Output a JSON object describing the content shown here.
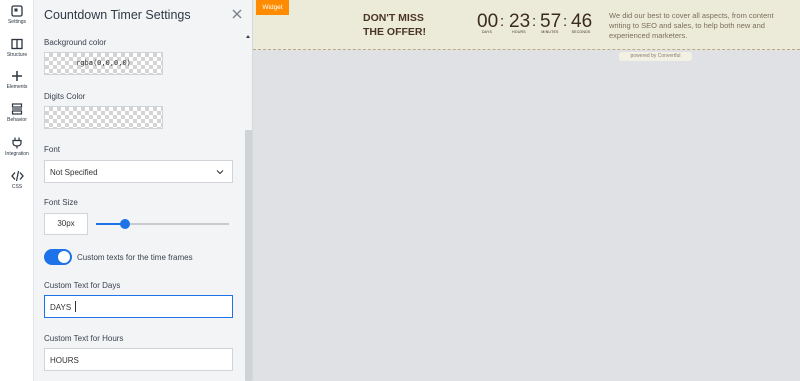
{
  "rail": {
    "items": [
      {
        "label": "Settings",
        "icon": "settings-icon"
      },
      {
        "label": "Structure",
        "icon": "structure-icon"
      },
      {
        "label": "Elements",
        "icon": "plus-icon"
      },
      {
        "label": "Behavior",
        "icon": "behavior-icon"
      },
      {
        "label": "Integration",
        "icon": "plug-icon"
      },
      {
        "label": "CSS",
        "icon": "code-icon"
      }
    ]
  },
  "panel": {
    "title": "Countdown Timer Settings",
    "background_color": {
      "label": "Background color",
      "value": "rgba(0,0,0,0)"
    },
    "digits_color": {
      "label": "Digits Color",
      "value": ""
    },
    "font": {
      "label": "Font",
      "value": "Not Specified"
    },
    "font_size": {
      "label": "Font Size",
      "value": "30px",
      "slider_fraction": 0.22
    },
    "custom_texts": {
      "label": "Custom texts for the time frames",
      "enabled": true
    },
    "days_text": {
      "label": "Custom Text for Days",
      "value": "DAYS"
    },
    "hours_text": {
      "label": "Custom Text for Hours",
      "value": "HOURS"
    }
  },
  "canvas": {
    "widget_tag": "Widget",
    "headline_line1": "DON'T MISS",
    "headline_line2": "THE OFFER!",
    "timer": {
      "days": "00",
      "hours": "23",
      "minutes": "57",
      "seconds": "46",
      "days_label": "DAYS",
      "hours_label": "HOURS",
      "minutes_label": "MINUTES",
      "seconds_label": "SECONDS",
      "separator": ":"
    },
    "description": "We did our best to cover all aspects, from content writing to SEO and sales, to help both new and experienced marketers.",
    "powered_by": "powered by Convertful"
  },
  "colors": {
    "accent": "#1e73e8",
    "widget_tag": "#ff8c00",
    "banner_bg": "#ecebd9",
    "headline": "#4a3426"
  }
}
